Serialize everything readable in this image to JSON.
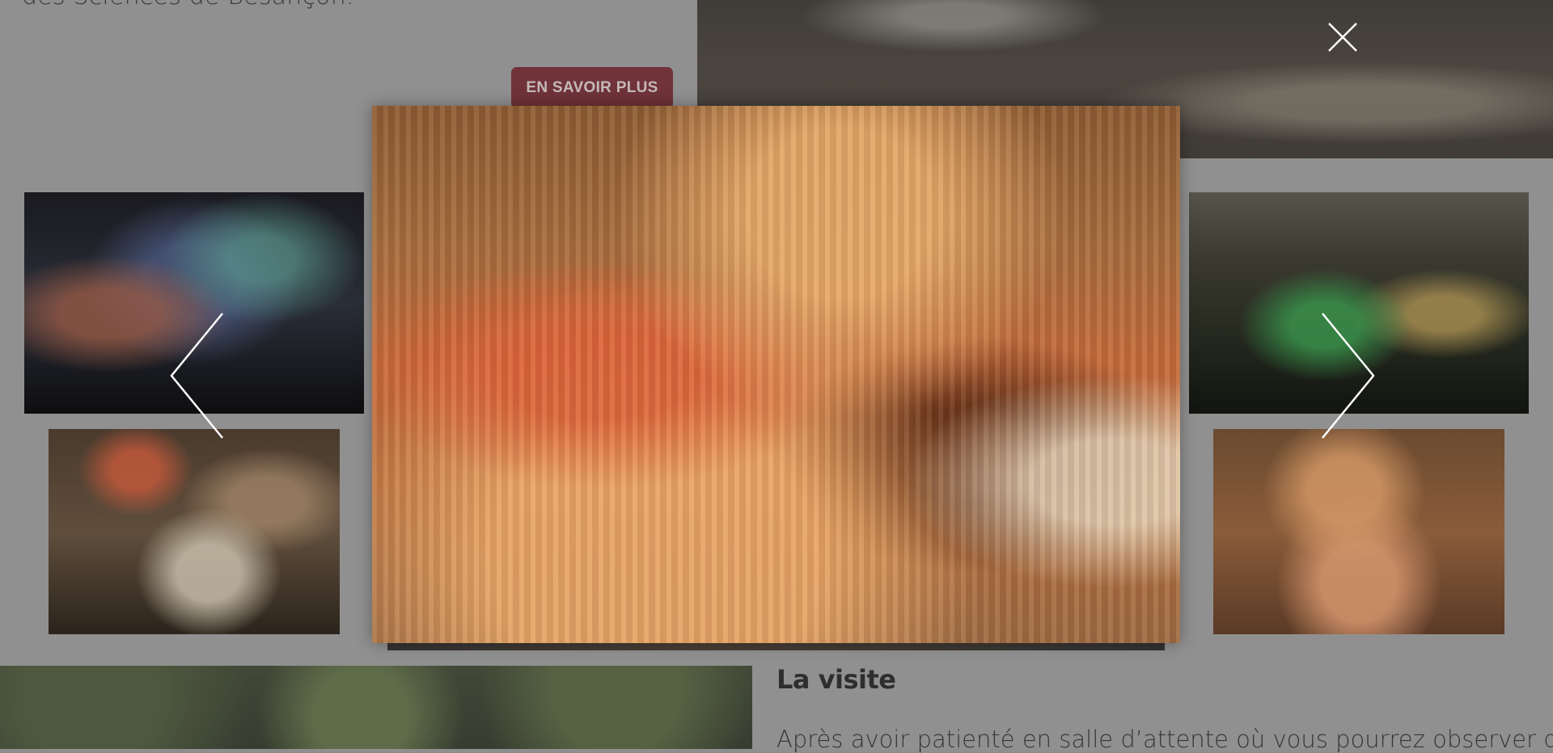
{
  "page": {
    "intro_text": "des Sciences de Besançon.",
    "cta_label": "EN SAVOIR PLUS",
    "section": {
      "title": "La visite",
      "body": "Après avoir patienté en salle d’attente où vous pourrez observer des"
    }
  },
  "lightbox": {
    "close_icon": "close-icon",
    "prev_icon": "chevron-left-icon",
    "next_icon": "chevron-right-icon",
    "thumbnails": [
      "cave-blue-lights",
      "cave-stalagmites",
      "cave-green-lights",
      "cave-orange-formations"
    ]
  },
  "colors": {
    "cta_background": "#6d1a22",
    "overlay": "#8f8f8f",
    "icon": "#ffffff"
  }
}
